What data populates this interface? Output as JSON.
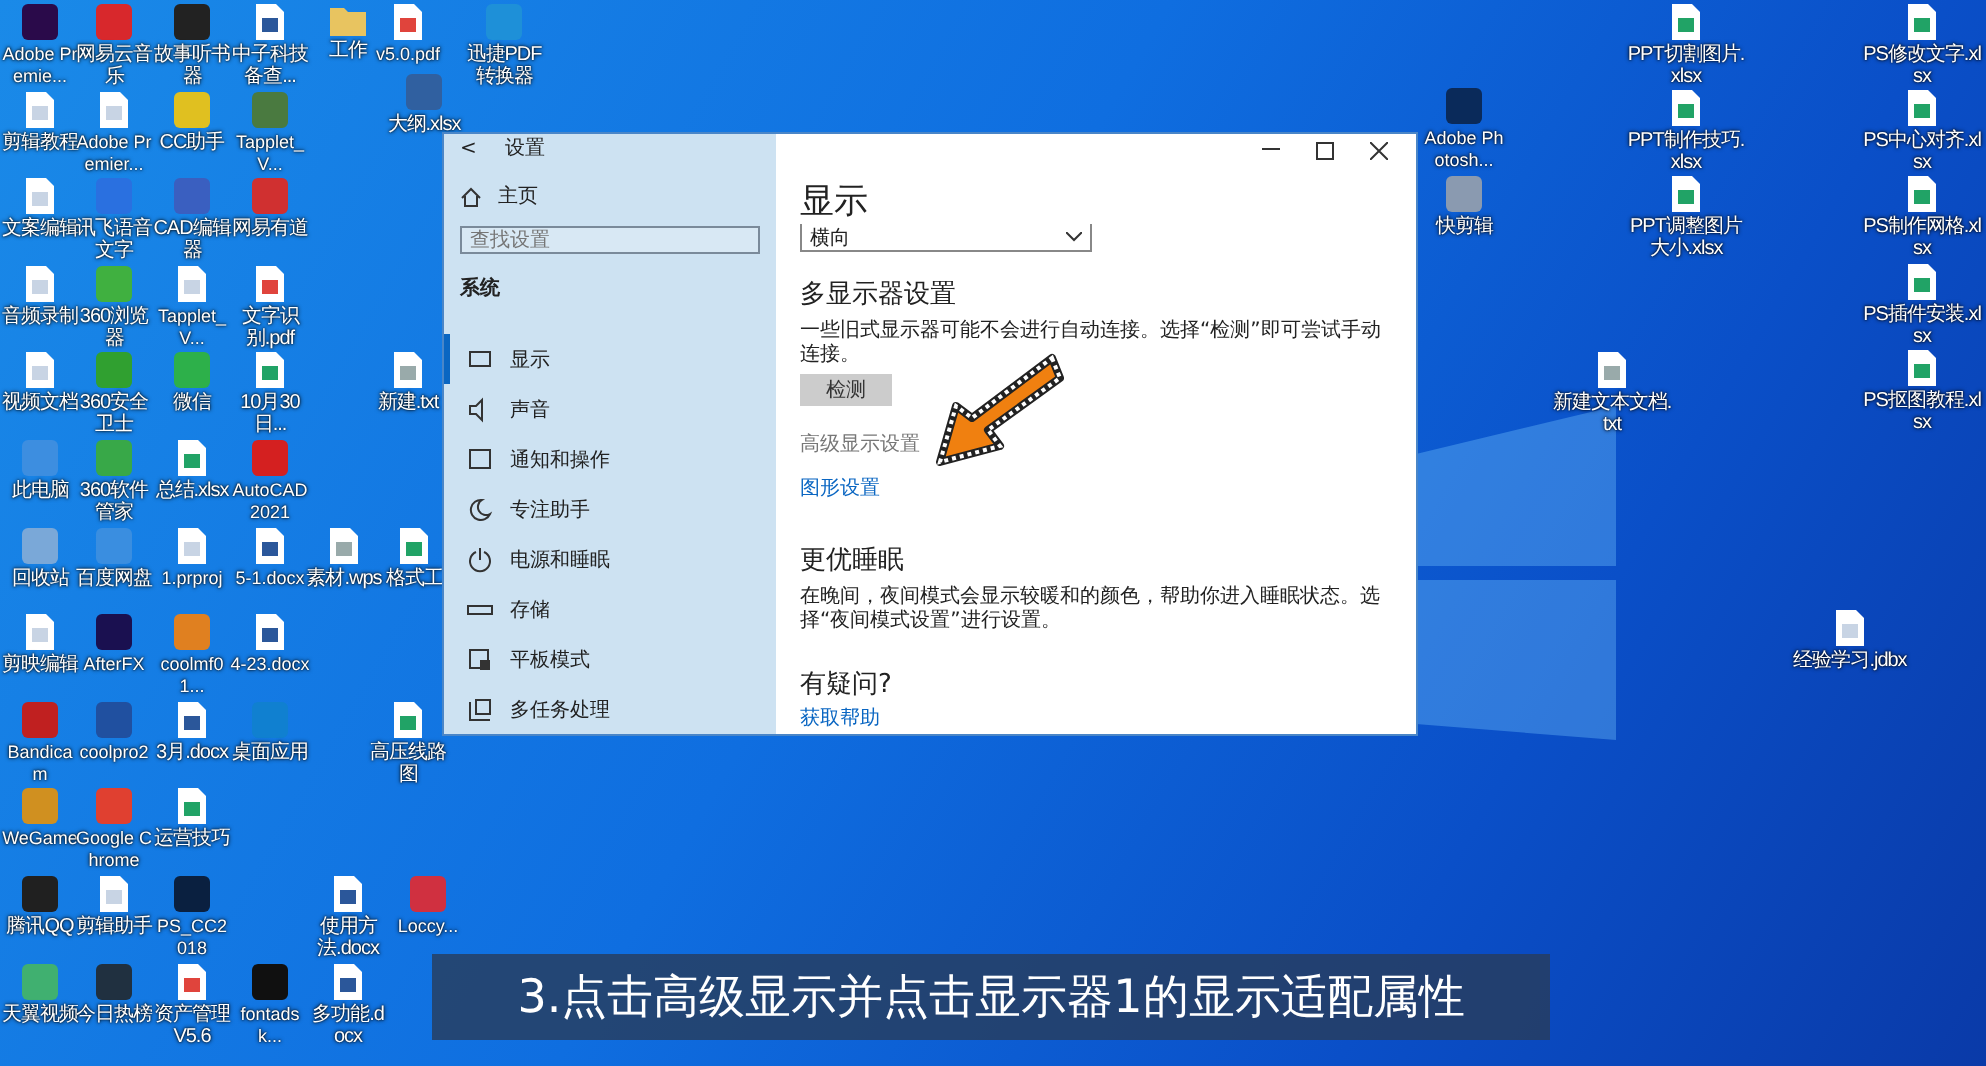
{
  "desktop_icons": [
    {
      "label": "Adobe Premie...",
      "kind": "app",
      "color": "#2a0a4a"
    },
    {
      "label": "网易云音乐",
      "kind": "app",
      "color": "#d8282c"
    },
    {
      "label": "故事听书器",
      "kind": "app",
      "color": "#222222"
    },
    {
      "label": "中子科技备查...",
      "kind": "word"
    },
    {
      "label": "工作",
      "kind": "folder"
    },
    {
      "label": "v5.0.pdf",
      "kind": "pdf"
    },
    {
      "label": "迅捷PDF转换器",
      "kind": "app",
      "color": "#1e90d8"
    },
    {
      "label": "剪辑教程",
      "kind": "file"
    },
    {
      "label": "Adobe Premier...",
      "kind": "file"
    },
    {
      "label": "CC助手",
      "kind": "app",
      "color": "#e0c020"
    },
    {
      "label": "Tapplet_V...",
      "kind": "app",
      "color": "#4a7a40"
    },
    {
      "label": "大纲.xlsx",
      "kind": "app",
      "color": "#3060a0"
    },
    {
      "label": "文案编辑",
      "kind": "file"
    },
    {
      "label": "讯飞语音文字",
      "kind": "app",
      "color": "#2a70e0"
    },
    {
      "label": "CAD编辑器",
      "kind": "app",
      "color": "#3a5fc0"
    },
    {
      "label": "网易有道",
      "kind": "app",
      "color": "#d03030"
    },
    {
      "label": "音频录制",
      "kind": "file"
    },
    {
      "label": "360浏览器",
      "kind": "app",
      "color": "#40b040"
    },
    {
      "label": "Tapplet_V...",
      "kind": "file"
    },
    {
      "label": "文字识别.pdf",
      "kind": "pdf"
    },
    {
      "label": "视频文档",
      "kind": "file"
    },
    {
      "label": "360安全卫士",
      "kind": "app",
      "color": "#30a030"
    },
    {
      "label": "微信",
      "kind": "app",
      "color": "#2db04a"
    },
    {
      "label": "10月30日...",
      "kind": "excel"
    },
    {
      "label": "新建.txt",
      "kind": "txt"
    },
    {
      "label": "此电脑",
      "kind": "app",
      "color": "#3d8ee0"
    },
    {
      "label": "360软件管家",
      "kind": "app",
      "color": "#38a848"
    },
    {
      "label": "总结.xlsx",
      "kind": "excel"
    },
    {
      "label": "AutoCAD 2021",
      "kind": "app",
      "color": "#d42020"
    },
    {
      "label": "回收站",
      "kind": "app",
      "color": "#7aa8d8"
    },
    {
      "label": "百度网盘",
      "kind": "app",
      "color": "#3a8ee0"
    },
    {
      "label": "1.prproj",
      "kind": "file"
    },
    {
      "label": "5-1.docx",
      "kind": "word"
    },
    {
      "label": "素材.wps",
      "kind": "txt"
    },
    {
      "label": "格式工",
      "kind": "excel"
    },
    {
      "label": "剪映编辑",
      "kind": "file"
    },
    {
      "label": "AfterFX",
      "kind": "app",
      "color": "#1a1050"
    },
    {
      "label": "coolmf01...",
      "kind": "app",
      "color": "#e08020"
    },
    {
      "label": "4-23.docx",
      "kind": "word"
    },
    {
      "label": "Bandicam",
      "kind": "app",
      "color": "#c02020"
    },
    {
      "label": "coolpro2",
      "kind": "app",
      "color": "#2050a0"
    },
    {
      "label": "3月.docx",
      "kind": "word"
    },
    {
      "label": "桌面应用",
      "kind": "app",
      "color": "#1080d0"
    },
    {
      "label": "高压线路图",
      "kind": "excel"
    },
    {
      "label": "WeGame",
      "kind": "app",
      "color": "#d09020"
    },
    {
      "label": "Google Chrome",
      "kind": "app",
      "color": "#e04030"
    },
    {
      "label": "运营技巧",
      "kind": "excel"
    },
    {
      "label": "腾讯QQ",
      "kind": "app",
      "color": "#202020"
    },
    {
      "label": "剪辑助手",
      "kind": "file"
    },
    {
      "label": "PS_CC2018",
      "kind": "app",
      "color": "#0a2040"
    },
    {
      "label": "使用方法.docx",
      "kind": "word"
    },
    {
      "label": "Loccy...",
      "kind": "app",
      "color": "#d03040"
    },
    {
      "label": "天翼视频",
      "kind": "app",
      "color": "#40b070"
    },
    {
      "label": "今日热榜",
      "kind": "app",
      "color": "#203040"
    },
    {
      "label": "资产管理V5.6",
      "kind": "pdf"
    },
    {
      "label": "fontadsk...",
      "kind": "app",
      "color": "#101010"
    },
    {
      "label": "多功能.docx",
      "kind": "word"
    },
    {
      "label": "PPT切割图片.xlsx",
      "kind": "excel"
    },
    {
      "label": "PS修改文字.xlsx",
      "kind": "excel"
    },
    {
      "label": "Adobe Photosh...",
      "kind": "app",
      "color": "#0a2a5a"
    },
    {
      "label": "PPT制作技巧.xlsx",
      "kind": "excel"
    },
    {
      "label": "PS中心对齐.xlsx",
      "kind": "excel"
    },
    {
      "label": "快剪辑",
      "kind": "app",
      "color": "#8a9ab0"
    },
    {
      "label": "PPT调整图片大小.xlsx",
      "kind": "excel"
    },
    {
      "label": "PS制作网格.xlsx",
      "kind": "excel"
    },
    {
      "label": "PS插件安装.xlsx",
      "kind": "excel"
    },
    {
      "label": "新建文本文档.txt",
      "kind": "txt"
    },
    {
      "label": "PS抠图教程.xlsx",
      "kind": "excel"
    },
    {
      "label": "经验学习.jdbx",
      "kind": "file"
    }
  ],
  "settings": {
    "title": "设置",
    "back": "<",
    "home": "主页",
    "search_placeholder": "查找设置",
    "section": "系统",
    "nav": [
      {
        "label": "显示",
        "kind": "display",
        "selected": true
      },
      {
        "label": "声音",
        "kind": "sound",
        "selected": false
      },
      {
        "label": "通知和操作",
        "kind": "notify",
        "selected": false
      },
      {
        "label": "专注助手",
        "kind": "moon",
        "selected": false
      },
      {
        "label": "电源和睡眠",
        "kind": "power",
        "selected": false
      },
      {
        "label": "存储",
        "kind": "storage",
        "selected": false
      },
      {
        "label": "平板模式",
        "kind": "tablet",
        "selected": false
      },
      {
        "label": "多任务处理",
        "kind": "multi",
        "selected": false
      }
    ],
    "heading": "显示",
    "orientation_value": "横向",
    "multi_heading": "多显示器设置",
    "multi_text": "一些旧式显示器可能不会进行自动连接。选择“检测”即可尝试手动连接。",
    "detect_button": "检测",
    "advanced_link": "高级显示设置",
    "graphics_link": "图形设置",
    "sleep_heading": "更优睡眠",
    "sleep_text": "在晚间，夜间模式会显示较暖和的颜色，帮助你进入睡眠状态。选择“夜间模式设置”进行设置。",
    "help_heading": "有疑问?",
    "help_link": "获取帮助"
  },
  "caption": "3.点击高级显示并点击显示器1的显示适配属性"
}
